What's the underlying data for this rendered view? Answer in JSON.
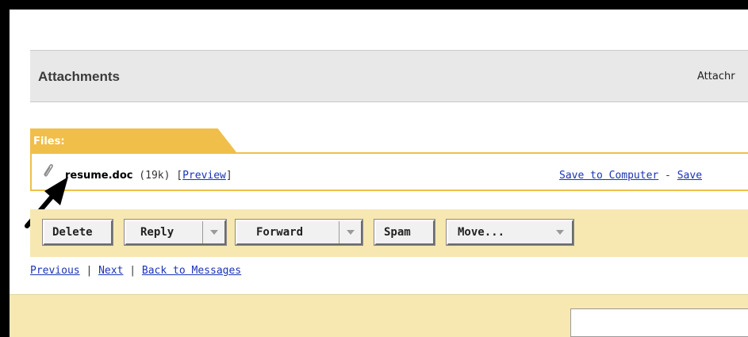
{
  "attachments": {
    "title": "Attachments",
    "right_text": "Attachr"
  },
  "files": {
    "label": "Files:",
    "file_name": "resume.doc",
    "file_size": "(19k)",
    "bracket_open": "[",
    "preview_label": "Preview",
    "bracket_close": "]",
    "save_computer_label": "Save to Computer",
    "separator": " - ",
    "save_other_label": "Save"
  },
  "toolbar": {
    "delete_label": "Delete",
    "reply_label": "Reply",
    "forward_label": "Forward",
    "spam_label": "Spam",
    "move_label": "Move..."
  },
  "nav": {
    "previous_label": "Previous",
    "sep": " | ",
    "next_label": "Next",
    "back_label": "Back to Messages"
  },
  "colors": {
    "tab": "#f0bf4a",
    "band": "#f7e7b1",
    "link": "#1a33b8",
    "header_bg": "#e8e8e8"
  },
  "icons": {
    "attachment": "paperclip-icon",
    "annotation": "arrow-pointer-icon"
  }
}
